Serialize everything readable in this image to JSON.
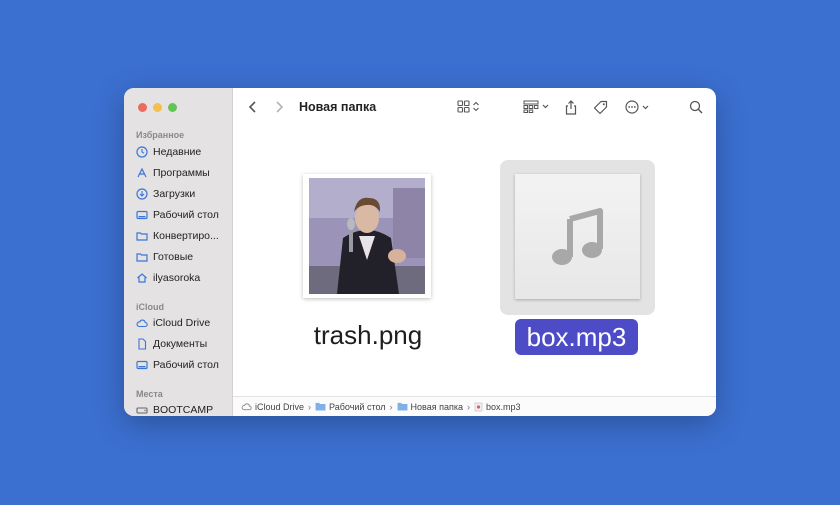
{
  "window": {
    "title": "Новая папка"
  },
  "sidebar": {
    "favorites_header": "Избранное",
    "favorites": [
      {
        "label": "Недавние",
        "icon": "clock-icon"
      },
      {
        "label": "Программы",
        "icon": "apps-icon"
      },
      {
        "label": "Загрузки",
        "icon": "download-icon"
      },
      {
        "label": "Рабочий стол",
        "icon": "desktop-icon"
      },
      {
        "label": "Конвертиро...",
        "icon": "folder-icon"
      },
      {
        "label": "Готовые",
        "icon": "folder-icon"
      },
      {
        "label": "ilyasoroka",
        "icon": "home-icon"
      }
    ],
    "icloud_header": "iCloud",
    "icloud": [
      {
        "label": "iCloud Drive",
        "icon": "cloud-icon"
      },
      {
        "label": "Документы",
        "icon": "document-icon"
      },
      {
        "label": "Рабочий стол",
        "icon": "desktop-icon"
      }
    ],
    "places_header": "Места",
    "places": [
      {
        "label": "BOOTCAMP",
        "icon": "drive-icon"
      }
    ]
  },
  "files": [
    {
      "name": "trash.png",
      "selected": false
    },
    {
      "name": "box.mp3",
      "selected": true
    }
  ],
  "pathbar": [
    "iCloud Drive",
    "Рабочий стол",
    "Новая папка",
    "box.mp3"
  ],
  "colors": {
    "background": "#3b6fd0",
    "selection": "#4d4bc6",
    "accent_icon": "#3a76d8"
  }
}
